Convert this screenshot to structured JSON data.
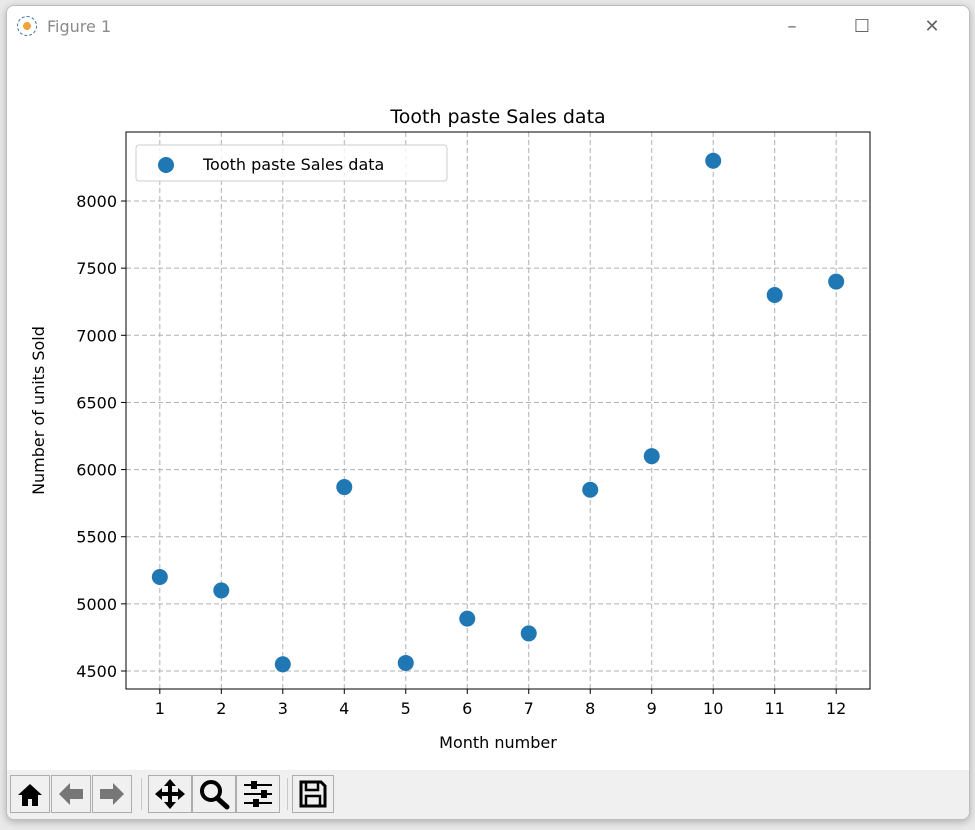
{
  "window": {
    "title": "Figure 1",
    "minimize_label": "–",
    "maximize_label": "☐",
    "close_label": "✕"
  },
  "toolbar": {
    "buttons": [
      {
        "name": "home",
        "icon": "home-icon"
      },
      {
        "name": "back",
        "icon": "arrow-left-icon"
      },
      {
        "name": "forward",
        "icon": "arrow-right-icon"
      },
      {
        "name": "pan",
        "icon": "move-icon"
      },
      {
        "name": "zoom",
        "icon": "magnifier-icon"
      },
      {
        "name": "configure-subplots",
        "icon": "sliders-icon"
      },
      {
        "name": "save",
        "icon": "floppy-disk-icon"
      }
    ]
  },
  "chart_data": {
    "type": "scatter",
    "title": "Tooth paste Sales data",
    "xlabel": "Month number",
    "ylabel": "Number of units Sold",
    "x": [
      1,
      2,
      3,
      4,
      5,
      6,
      7,
      8,
      9,
      10,
      11,
      12
    ],
    "series": [
      {
        "name": "Tooth paste Sales data",
        "color": "#1f77b4",
        "values": [
          5200,
          5100,
          4550,
          5870,
          4560,
          4890,
          4780,
          5850,
          6100,
          8300,
          7300,
          7400
        ]
      }
    ],
    "xticks": [
      1,
      2,
      3,
      4,
      5,
      6,
      7,
      8,
      9,
      10,
      11,
      12
    ],
    "yticks": [
      4500,
      5000,
      5500,
      6000,
      6500,
      7000,
      7500,
      8000
    ],
    "xlim": [
      0.45,
      12.55
    ],
    "ylim": [
      4366,
      8514
    ],
    "grid": true,
    "grid_style": "dashed",
    "legend_placement": "upper-left"
  }
}
